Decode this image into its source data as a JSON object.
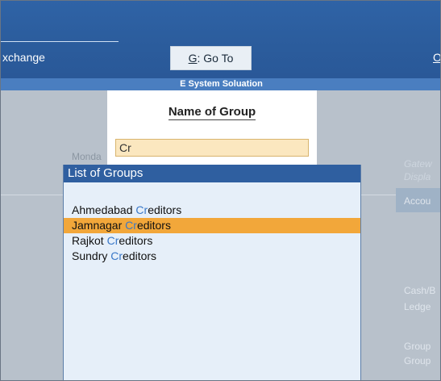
{
  "menu": {
    "exchange_label": "xchange",
    "goto_hotkey": "G",
    "goto_rest": ": Go To",
    "right_label": "O"
  },
  "company": {
    "name": "E System Soluation"
  },
  "background": {
    "ghost_left": "Monda",
    "ghost_right": [
      "Gatew",
      "Displa",
      "Accou",
      "Cash/B",
      "Ledge",
      "Group",
      "Group"
    ]
  },
  "name_of_group": {
    "title": "Name of Group",
    "input_value": "Cr"
  },
  "list_of_groups": {
    "title": "List of Groups",
    "items": [
      {
        "prefix": "Ahmedabad ",
        "match": "Cr",
        "rest": "editors",
        "selected": false
      },
      {
        "prefix": "Jamnagar ",
        "match": "Cr",
        "rest": "editors",
        "selected": true
      },
      {
        "prefix": "Rajkot ",
        "match": "Cr",
        "rest": "editors",
        "selected": false
      },
      {
        "prefix": "Sundry ",
        "match": "Cr",
        "rest": "editors",
        "selected": false
      }
    ]
  },
  "colors": {
    "topbar": "#2f63a6",
    "highlight": "#f2a73a",
    "match_text": "#3a78c8",
    "input_bg": "#fbe7bf"
  }
}
